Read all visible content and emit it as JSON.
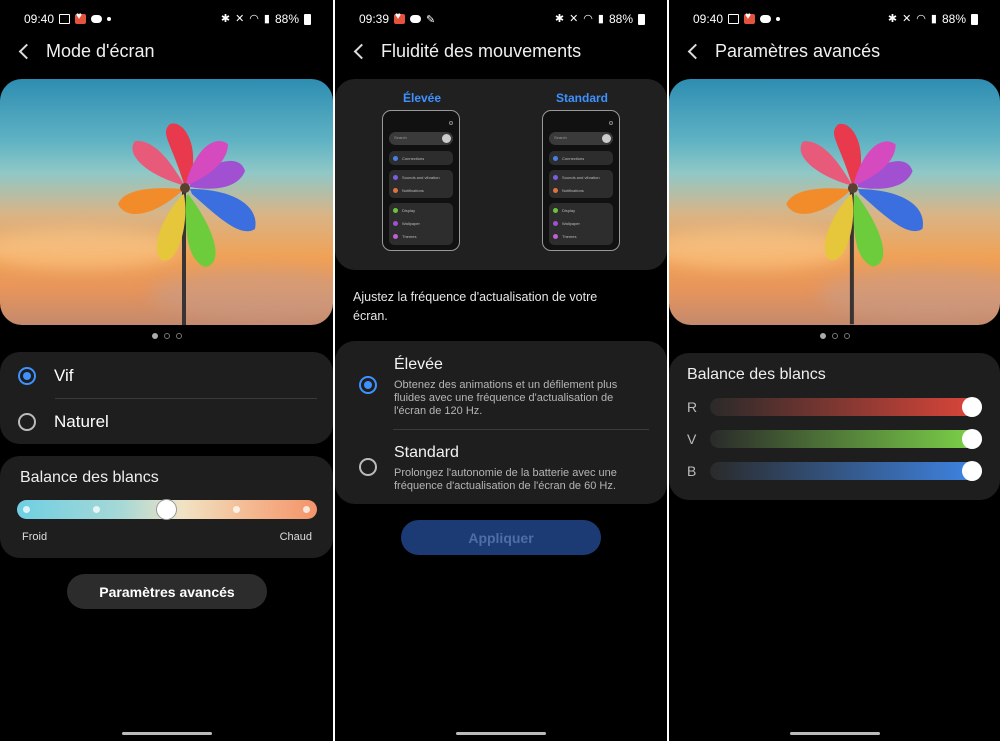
{
  "panel1": {
    "status": {
      "time": "09:40",
      "battery": "88%"
    },
    "title": "Mode d'écran",
    "modes": [
      {
        "label": "Vif",
        "selected": true
      },
      {
        "label": "Naturel",
        "selected": false
      }
    ],
    "white_balance": {
      "title": "Balance des blancs",
      "min_label": "Froid",
      "max_label": "Chaud",
      "steps": 5,
      "value_step": 3
    },
    "advanced_button": "Paramètres avancés",
    "carousel": {
      "count": 3,
      "active": 1
    }
  },
  "panel2": {
    "status": {
      "time": "09:39",
      "battery": "88%"
    },
    "title": "Fluidité des mouvements",
    "preview_labels": [
      "Élevée",
      "Standard"
    ],
    "preview_phone": {
      "search": "Search",
      "items": [
        "Connections",
        "Sounds and vibration",
        "Notifications",
        "Display",
        "Wallpaper",
        "Themes"
      ]
    },
    "description": "Ajustez la fréquence d'actualisation de votre écran.",
    "options": [
      {
        "label": "Élevée",
        "detail": "Obtenez des animations et un défilement plus fluides avec une fréquence d'actualisation de l'écran de 120 Hz.",
        "selected": true
      },
      {
        "label": "Standard",
        "detail": "Prolongez l'autonomie de la batterie avec une fréquence d'actualisation de l'écran de 60 Hz.",
        "selected": false
      }
    ],
    "apply_button": "Appliquer"
  },
  "panel3": {
    "status": {
      "time": "09:40",
      "battery": "88%"
    },
    "title": "Paramètres avancés",
    "white_balance_title": "Balance des blancs",
    "channels": [
      {
        "label": "R",
        "level": 1.0,
        "color": "#e0463a"
      },
      {
        "label": "V",
        "level": 1.0,
        "color": "#7ed64a"
      },
      {
        "label": "B",
        "level": 1.0,
        "color": "#3f86e8"
      }
    ],
    "carousel": {
      "count": 3,
      "active": 1
    }
  },
  "colors": {
    "accent": "#3e91ff",
    "card": "#1e1e1e"
  }
}
